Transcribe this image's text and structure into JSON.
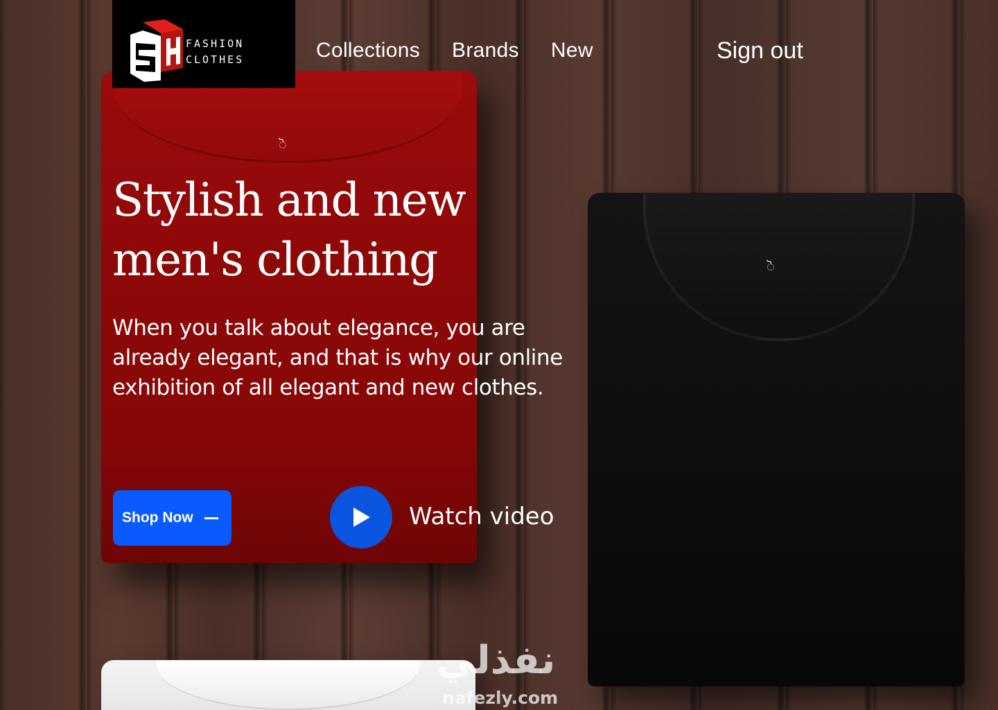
{
  "brand": {
    "line1": "FASHION",
    "line2": "CLOTHES",
    "monogram": "SH"
  },
  "nav": {
    "items": [
      {
        "label": "Collections"
      },
      {
        "label": "Brands"
      },
      {
        "label": "New"
      }
    ],
    "sign_out": "Sign out"
  },
  "hero": {
    "title": "Stylish and new men's clothing",
    "description": "When you talk about elegance, you are already elegant, and that is why our online exhibition of all elegant and new clothes.",
    "shop_now_label": "Shop Now",
    "watch_video_label": "Watch video"
  },
  "icons": {
    "play": "play-icon",
    "arrow": "dash-arrow-icon",
    "logo": "sh-logo-icon"
  },
  "colors": {
    "accent": "#0a5bff",
    "logo_red": "#e0201b",
    "red_shirt": "#8e0808",
    "black_shirt": "#0d0d0d"
  },
  "watermark": {
    "arabic": "نفذلي",
    "latin": "nafezly.com"
  },
  "shirt_tag": "ॆ"
}
